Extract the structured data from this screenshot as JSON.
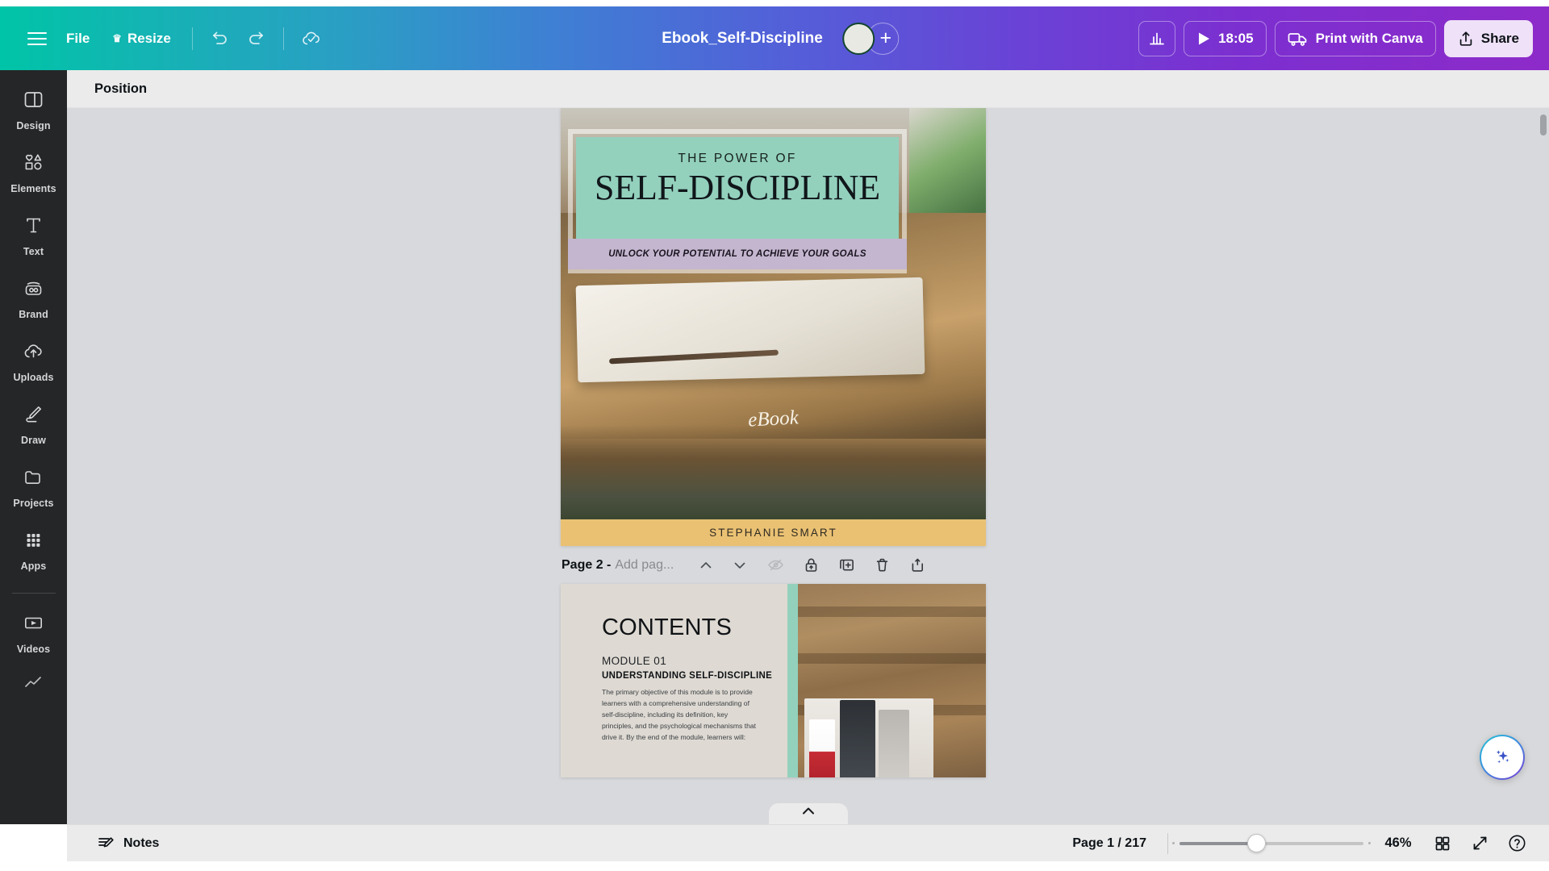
{
  "topbar": {
    "menu_icon": "hamburger-menu-icon",
    "file_label": "File",
    "resize_label": "Resize",
    "resize_crown_icon": "crown-icon",
    "undo_icon": "undo-icon",
    "redo_icon": "redo-icon",
    "saved_icon": "cloud-check-icon",
    "doc_title": "Ebook_Self-Discipline",
    "avatar_icon": "avatar",
    "add_collaborator_icon": "plus-icon",
    "insights_icon": "bar-chart-icon",
    "present_icon": "play-icon",
    "present_timer": "18:05",
    "print_icon": "delivery-truck-icon",
    "print_label": "Print with Canva",
    "share_icon": "share-upload-icon",
    "share_label": "Share"
  },
  "sidebar": {
    "items": [
      {
        "label": "Design",
        "icon": "design-layout-icon"
      },
      {
        "label": "Elements",
        "icon": "shapes-icon"
      },
      {
        "label": "Text",
        "icon": "text-t-icon"
      },
      {
        "label": "Brand",
        "icon": "brand-kit-icon"
      },
      {
        "label": "Uploads",
        "icon": "cloud-upload-icon"
      },
      {
        "label": "Draw",
        "icon": "pen-draw-icon"
      },
      {
        "label": "Projects",
        "icon": "folder-icon"
      },
      {
        "label": "Apps",
        "icon": "grid-apps-icon"
      },
      {
        "label": "Videos",
        "icon": "video-play-icon"
      }
    ]
  },
  "context_toolbar": {
    "position_label": "Position"
  },
  "canvas": {
    "cover": {
      "kicker": "THE POWER OF",
      "title": "SELF-DISCIPLINE",
      "subtitle": "UNLOCK YOUR POTENTIAL TO ACHIEVE YOUR GOALS",
      "ebook_script": "eBook",
      "author": "STEPHANIE SMART",
      "teal_color": "#93d1bd",
      "lavender_color": "#c4b6cf",
      "gold_color": "#eac173"
    },
    "page_tools": {
      "page_label": "Page 2 -",
      "name_placeholder": "Add pag...",
      "icons": [
        "chevron-up-icon",
        "chevron-down-icon",
        "hide-page-icon",
        "lock-page-icon",
        "duplicate-page-icon",
        "delete-page-icon",
        "add-page-icon"
      ]
    },
    "page2": {
      "heading": "CONTENTS",
      "module_number": "MODULE 01",
      "module_title": "UNDERSTANDING SELF-DISCIPLINE",
      "body": "The primary objective of this module is to provide learners with a comprehensive understanding of self-discipline, including its definition, key principles, and the psychological mechanisms that drive it. By the end of the module, learners will:"
    },
    "collapse_icon": "chevron-up-icon",
    "magic_icon": "magic-sparkles-icon",
    "scrollbar": "vertical-scrollbar"
  },
  "bottombar": {
    "notes_icon": "notes-edit-icon",
    "notes_label": "Notes",
    "page_indicator": "Page 1 / 217",
    "zoom_level": "46%",
    "grid_icon": "grid-view-icon",
    "fullscreen_icon": "expand-fullscreen-icon",
    "help_icon": "help-question-icon"
  }
}
